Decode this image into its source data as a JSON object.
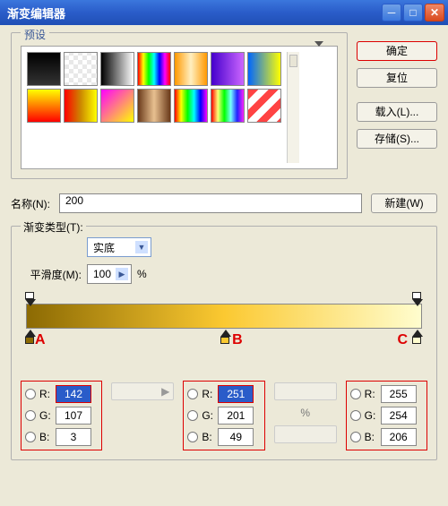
{
  "title": "渐变编辑器",
  "presets_label": "预设",
  "buttons": {
    "ok": "确定",
    "reset": "复位",
    "load": "载入(L)...",
    "save": "存储(S)..."
  },
  "name_label": "名称(N):",
  "name_value": "200",
  "new_btn": "新建(W)",
  "type_label": "渐变类型(T):",
  "type_value": "实底",
  "smooth_label": "平滑度(M):",
  "smooth_value": "100",
  "smooth_unit": "%",
  "annotations": {
    "a": "A",
    "b": "B",
    "c": "C"
  },
  "rgb": {
    "r_label": "R:",
    "g_label": "G:",
    "b_label": "B:",
    "a": {
      "r": "142",
      "g": "107",
      "b": "3"
    },
    "b": {
      "r": "251",
      "g": "201",
      "b": "49"
    },
    "c": {
      "r": "255",
      "g": "254",
      "b": "206"
    }
  },
  "pct": "%",
  "presets": [
    "linear-gradient(to bottom,#000,#333)",
    "repeating-conic-gradient(#fff 0 25%,#e8e8e8 0 50%) 0/10px 10px",
    "linear-gradient(to right,#000,#fff)",
    "linear-gradient(to right,#f00,#ff0,#0f0,#0ff,#00f,#f0f,#f00)",
    "linear-gradient(to right,#f90,#ffefc0,#f90)",
    "linear-gradient(to right,#40c,#c6f)",
    "linear-gradient(to right,#06f,#ff0)",
    "linear-gradient(to bottom,#ff0,#f00)",
    "linear-gradient(to right,#f00,#c80,#ff0)",
    "linear-gradient(135deg,#f0f,#ff0)",
    "linear-gradient(to right,#6a3a1a,#e8c090,#6a3a1a)",
    "linear-gradient(to right,#f00,#ff0,#0f0,#0ff,#00f,#f0f)",
    "linear-gradient(to right,#f00,#ff7,#0f0,#7ff,#22f,#f2f)",
    "repeating-linear-gradient(135deg,#f44 0 8px,#fff 8px 16px)"
  ]
}
